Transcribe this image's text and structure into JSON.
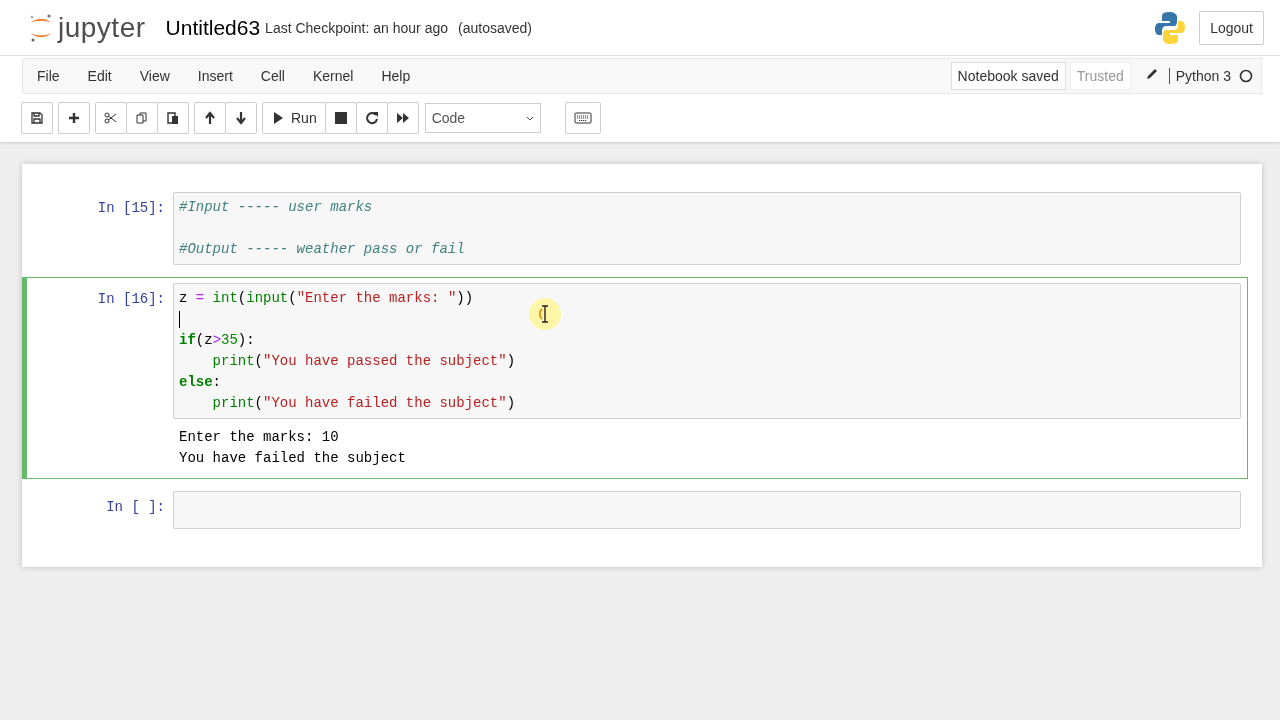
{
  "header": {
    "logo_text": "jupyter",
    "notebook_name": "Untitled63",
    "checkpoint": "Last Checkpoint: an hour ago",
    "autosave": "(autosaved)",
    "logout": "Logout"
  },
  "menu": {
    "items": [
      "File",
      "Edit",
      "View",
      "Insert",
      "Cell",
      "Kernel",
      "Help"
    ],
    "notification": "Notebook saved",
    "trusted": "Trusted",
    "kernel_name": "Python 3",
    "kernel_busy": false
  },
  "toolbar": {
    "run_label": "Run",
    "cell_type": "Code"
  },
  "cells": [
    {
      "prompt": "In [15]:",
      "selected": false,
      "lines": [
        {
          "kind": "code",
          "tokens": [
            {
              "kind": "comment",
              "text": "#Input ----- user marks"
            }
          ]
        },
        {
          "kind": "blank"
        },
        {
          "kind": "code",
          "tokens": [
            {
              "kind": "comment",
              "text": "#Output ----- weather pass or fail"
            }
          ]
        }
      ]
    },
    {
      "prompt": "In [16]:",
      "selected": true,
      "lines": [
        {
          "kind": "code",
          "tokens": [
            {
              "kind": "plain",
              "text": "z "
            },
            {
              "kind": "operator",
              "text": "="
            },
            {
              "kind": "builtin",
              "text": " int"
            },
            {
              "kind": "plain",
              "text": "("
            },
            {
              "kind": "builtin",
              "text": "input"
            },
            {
              "kind": "plain",
              "text": "("
            },
            {
              "kind": "string",
              "text": "\"Enter the marks: \""
            },
            {
              "kind": "plain",
              "text": "))"
            }
          ]
        },
        {
          "kind": "cursor"
        },
        {
          "kind": "code",
          "tokens": [
            {
              "kind": "keyword",
              "text": "if"
            },
            {
              "kind": "plain",
              "text": "(z"
            },
            {
              "kind": "operator",
              "text": ">"
            },
            {
              "kind": "number",
              "text": "35"
            },
            {
              "kind": "plain",
              "text": "):"
            }
          ]
        },
        {
          "kind": "indented",
          "tokens": [
            {
              "kind": "builtin",
              "text": "print"
            },
            {
              "kind": "plain",
              "text": "("
            },
            {
              "kind": "string",
              "text": "\"You have passed the subject\""
            },
            {
              "kind": "plain",
              "text": ")"
            }
          ]
        },
        {
          "kind": "code",
          "tokens": [
            {
              "kind": "keyword",
              "text": "else"
            },
            {
              "kind": "plain",
              "text": ":"
            }
          ]
        },
        {
          "kind": "indented",
          "tokens": [
            {
              "kind": "builtin",
              "text": "print"
            },
            {
              "kind": "plain",
              "text": "("
            },
            {
              "kind": "string",
              "text": "\"You have failed the subject\""
            },
            {
              "kind": "plain",
              "text": ")"
            }
          ]
        }
      ],
      "output": [
        "Enter the marks: 10",
        "You have failed the subject"
      ]
    },
    {
      "prompt": "In [ ]:",
      "selected": false,
      "lines": [
        {
          "kind": "blank"
        }
      ]
    }
  ]
}
